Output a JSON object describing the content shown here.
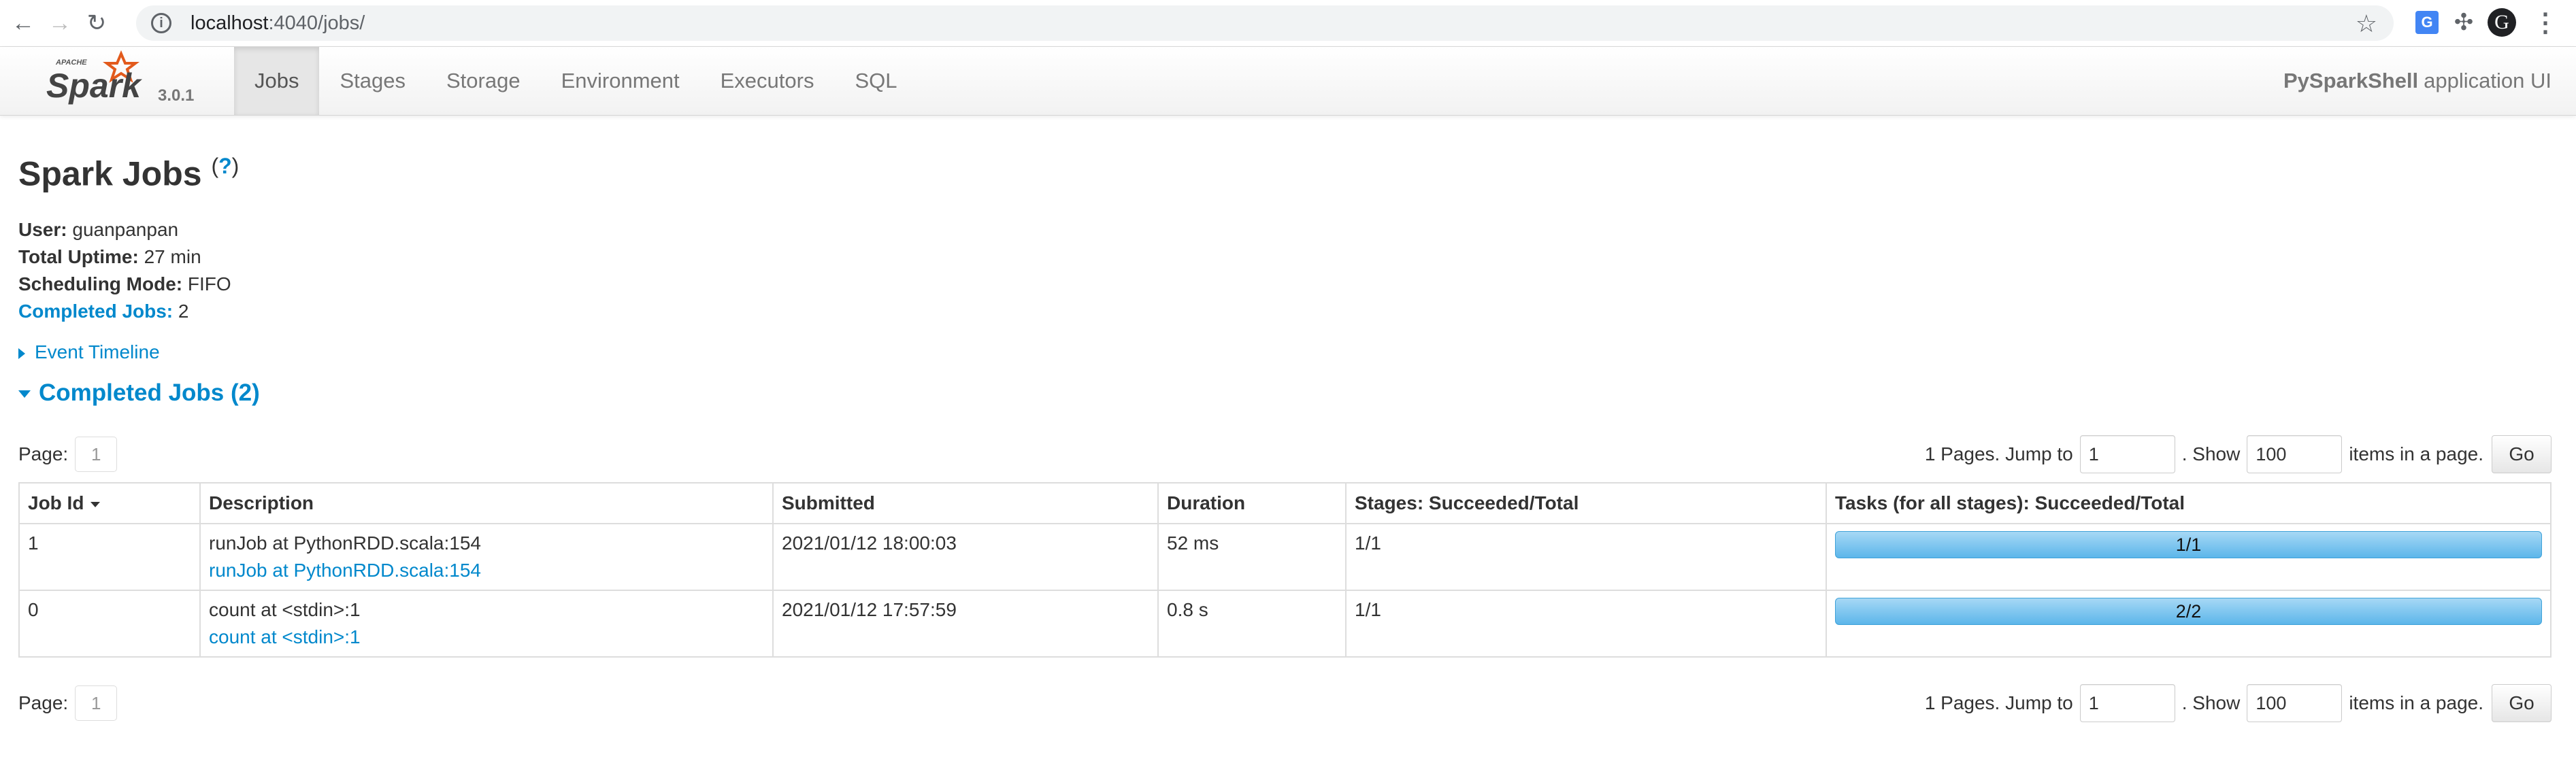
{
  "browser": {
    "url_host": "localhost",
    "url_path": ":4040/jobs/"
  },
  "navbar": {
    "version": "3.0.1",
    "tabs": [
      {
        "label": "Jobs",
        "active": true
      },
      {
        "label": "Stages",
        "active": false
      },
      {
        "label": "Storage",
        "active": false
      },
      {
        "label": "Environment",
        "active": false
      },
      {
        "label": "Executors",
        "active": false
      },
      {
        "label": "SQL",
        "active": false
      }
    ],
    "app_name": "PySparkShell",
    "app_suffix": "application UI"
  },
  "page": {
    "title": "Spark Jobs",
    "help": "?"
  },
  "summary": {
    "user_label": "User:",
    "user": "guanpanpan",
    "uptime_label": "Total Uptime:",
    "uptime": "27 min",
    "scheduling_label": "Scheduling Mode:",
    "scheduling": "FIFO",
    "completed_label": "Completed Jobs:",
    "completed": "2"
  },
  "event_timeline": "Event Timeline",
  "completed_section": "Completed Jobs (2)",
  "pager": {
    "page_label": "Page:",
    "page": "1",
    "pages_text": "1 Pages. Jump to",
    "jump_value": "1",
    "show_text": ". Show",
    "show_value": "100",
    "items_text": "items in a page.",
    "go": "Go"
  },
  "table": {
    "headers": [
      "Job Id",
      "Description",
      "Submitted",
      "Duration",
      "Stages: Succeeded/Total",
      "Tasks (for all stages): Succeeded/Total"
    ],
    "rows": [
      {
        "id": "1",
        "desc": "runJob at PythonRDD.scala:154",
        "desc_link": "runJob at PythonRDD.scala:154",
        "submitted": "2021/01/12 18:00:03",
        "duration": "52 ms",
        "stages": "1/1",
        "tasks": "1/1",
        "tasks_fraction": 1.0
      },
      {
        "id": "0",
        "desc": "count at <stdin>:1",
        "desc_link": "count at <stdin>:1",
        "submitted": "2021/01/12 17:57:59",
        "duration": "0.8 s",
        "stages": "1/1",
        "tasks": "2/2",
        "tasks_fraction": 1.0
      }
    ]
  },
  "colors": {
    "link": "#0088cc",
    "progress": "#5cb6ea"
  }
}
